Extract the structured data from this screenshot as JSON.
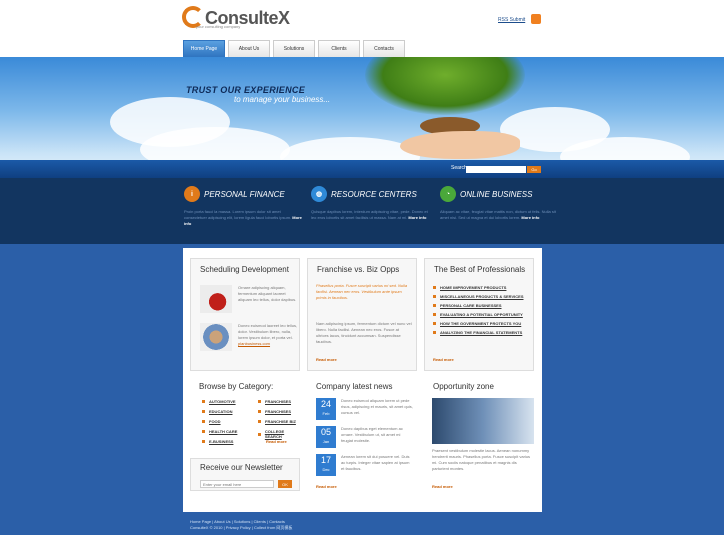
{
  "brand": {
    "name": "ConsulteX",
    "tagline": "your consulting company"
  },
  "rss": {
    "label": "RSS Submit"
  },
  "nav": [
    {
      "label": "Home Page",
      "active": true
    },
    {
      "label": "About Us",
      "active": false
    },
    {
      "label": "Solutions",
      "active": false
    },
    {
      "label": "Clients",
      "active": false
    },
    {
      "label": "Contacts",
      "active": false
    }
  ],
  "hero": {
    "title": "TRUST OUR EXPERIENCE",
    "subtitle": "to manage your business..."
  },
  "search": {
    "label": "Search",
    "button": "Go"
  },
  "features": [
    {
      "title": "PERSONAL FINANCE",
      "icon": "info-icon",
      "color": "#e07a1a",
      "text": "Proin porta fauci la massa. Lorem ipsum dolor sit amet consectetuer adipiscing elit, lorem ligula fauci lobortis ipsum.",
      "more": "More info"
    },
    {
      "title": "RESOURCE CENTERS",
      "icon": "globe-icon",
      "color": "#2f8ad8",
      "text": "Quisque dapibus lorem, interdum adipiscing vitae, pede. Donec et leo eros lobortis sit amet facilisis ut massa. Nam at mi.",
      "more": "More info"
    },
    {
      "title": "ONLINE BUSINESS",
      "icon": "pie-chart-icon",
      "color": "#4aa83a",
      "text": "Aliquam ac vitae, feugiat vitae mattis non, dictum ut felis. Nulla sit amet nisi. Sed ut magna et dui lobortis lorem.",
      "more": "More info"
    }
  ],
  "scheduling": {
    "title": "Scheduling Development",
    "text1": "Ornare adipiscing aliquam, fermentum aliquant laoreet aliquam leo tellus, dolor dapibus.",
    "text2": "Donec euismod laoreet leo tellus, dolor. Vestibulum libero, nulla, lorem ipsum dolor, et porta vel.",
    "link": "planbusiness.com"
  },
  "franchise": {
    "title": "Franchise vs. Biz Opps",
    "lead": "Phasellus porta. Fusce suscipit varius mi sed. Nulla facilisi. Aenean nec eros. Vestibulum ante ipsum primis in faucibus.",
    "body": "Nam adipiscing ipsum, fermentum dictum vel nunc vel libero. Nulla facilisi. Aenean nec eros. Fusce at ultrices lacus, tincidunt accumsan. Suspendisse faucibus.",
    "more": "Read more"
  },
  "professionals": {
    "title": "The Best of Professionals",
    "items": [
      "HOME IMPROVEMENT PRODUCTS",
      "MISCELLANEOUS PRODUCTS & SERVICES",
      "PERSONAL CARE BUSINESSES",
      "EVALUATING A POTENTIAL OPPORTUNITY",
      "HOW THE GOVERNMENT PROTECTS YOU",
      "ANALYZING THE FINANCIAL STATEMENTS"
    ],
    "more": "Read more"
  },
  "browse": {
    "title": "Browse by Category:",
    "col1": [
      "AUTOMOTIVE",
      "EDUCATION",
      "FOOD",
      "HEALTH CARE",
      "E-BUSINESS"
    ],
    "col2": [
      "FRANCHISES",
      "FRANCHISES",
      "FRANCHISE BIZ",
      "COLLEGE SEARCH"
    ],
    "more": "Read more"
  },
  "newsletter": {
    "title": "Receive our Newsletter",
    "placeholder": "Enter your email here",
    "button": "OK"
  },
  "news": {
    "title": "Company latest news",
    "items": [
      {
        "day": "24",
        "month": "Feb",
        "text": "Donec euismod aliquam lorem ut pede risus, adipiscing et mauris, sit amet quis, cursus vel."
      },
      {
        "day": "05",
        "month": "Jan",
        "text": "Donec dapibus eget elementum ac ornare. Vestibulum ut, sit amet mi feugiat molestie."
      },
      {
        "day": "17",
        "month": "Dec",
        "text": "Aenean lorem sit dui posuere vel. Duis ac turpis. Integer vitae sapien at ipsum et faucibus."
      }
    ],
    "more": "Read more"
  },
  "opportunity": {
    "title": "Opportunity zone",
    "text": "Praesent vestibulum molestie lacus. Aenean nonummy hendrerit mauris. Phasellus porta. Fusce suscipit varius mi. Cum sociis natoque penatibus et magnis dis parturient montes.",
    "more": "Read more"
  },
  "footer": {
    "links": "Home Page  |  About Us  |  Solutions  |  Clients  |  Contacts",
    "copy": "ConsulteX © 2010  |  Privacy Policy  |  Collect from 网页模板"
  }
}
